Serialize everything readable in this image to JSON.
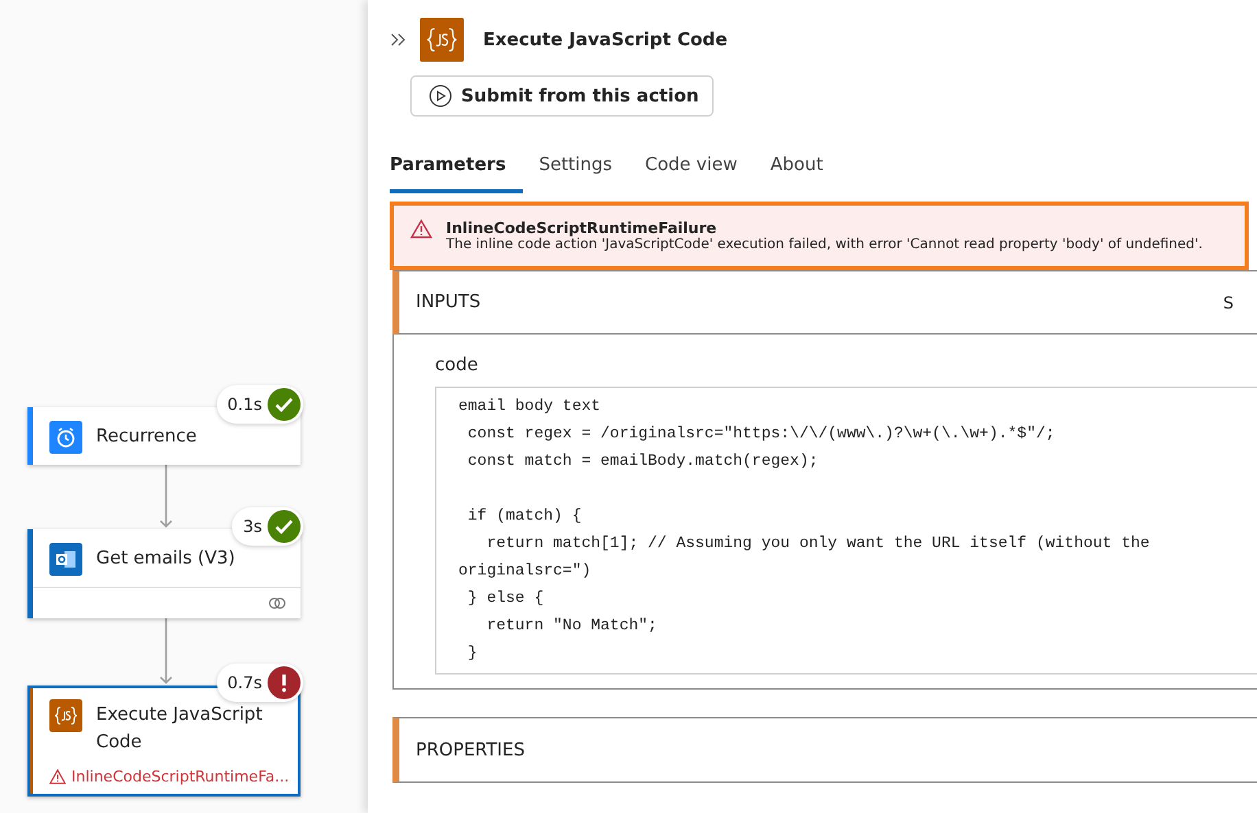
{
  "canvas": {
    "nodes": [
      {
        "kind": "recurrence",
        "title": "Recurrence",
        "duration": "0.1s",
        "succeeded": true,
        "selected": false,
        "footer_link": false
      },
      {
        "kind": "outlook",
        "title": "Get emails (V3)",
        "duration": "3s",
        "succeeded": true,
        "selected": false,
        "footer_link": true
      },
      {
        "kind": "javascript",
        "title": "Execute JavaScript Code",
        "duration": "0.7s",
        "succeeded": false,
        "selected": true,
        "footer_link": false,
        "error": "InlineCodeScriptRuntimeFa..."
      }
    ]
  },
  "panel": {
    "title": "Execute JavaScript Code",
    "submit_button": "Submit from this action",
    "tabs": [
      {
        "label": "Parameters",
        "selected": true
      },
      {
        "label": "Settings",
        "selected": false
      },
      {
        "label": "Code view",
        "selected": false
      },
      {
        "label": "About",
        "selected": false
      }
    ],
    "error": {
      "title": "InlineCodeScriptRuntimeFailure",
      "message": "The inline code action 'JavaScriptCode' execution failed, with error 'Cannot read property 'body' of undefined'."
    },
    "inputs": {
      "header": "INPUTS",
      "header_action": "S",
      "field_label": "code",
      "code_blocks": [
        [
          "email body text",
          " const regex = /originalsrc=\"https:\\/\\/(www\\.)?\\w+(\\.\\w+).*$\"/;",
          " const match = emailBody.match(regex);"
        ],
        [
          " if (match) {",
          "   return match[1]; // Assuming you only want the URL itself (without the",
          "originalsrc=\")",
          " } else {",
          "   return \"No Match\";",
          " }"
        ]
      ]
    },
    "properties": {
      "header": "PROPERTIES"
    }
  }
}
